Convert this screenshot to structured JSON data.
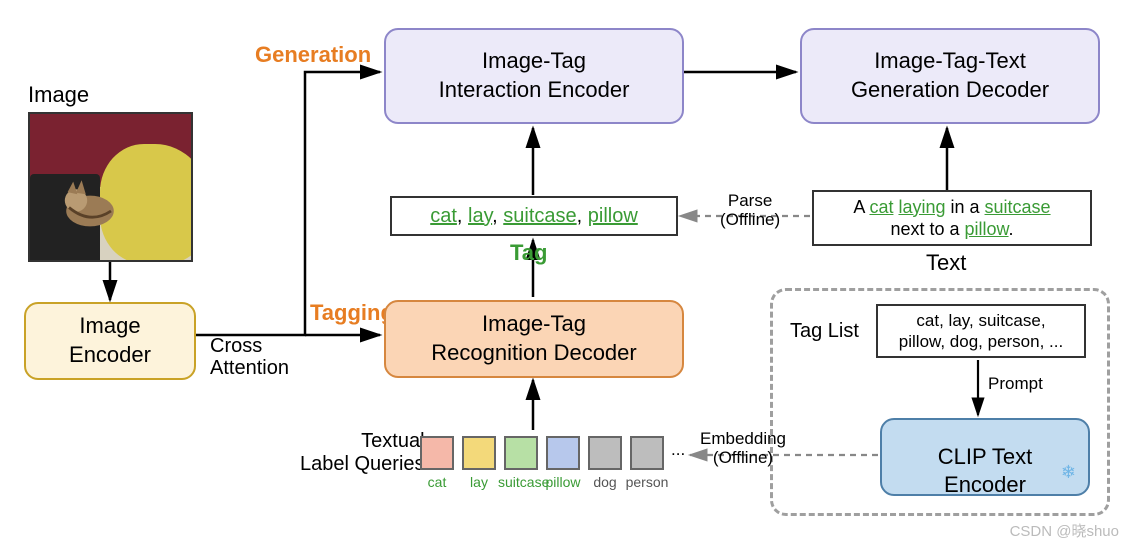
{
  "labels": {
    "image": "Image",
    "image_encoder": "Image\nEncoder",
    "generation": "Generation",
    "tagging": "Tagging",
    "cross_attention": "Cross\nAttention",
    "tag_heading": "Tag",
    "interaction_encoder": "Image-Tag\nInteraction Encoder",
    "generation_decoder": "Image-Tag-Text\nGeneration Decoder",
    "recognition_decoder": "Image-Tag\nRecognition Decoder",
    "text_heading": "Text",
    "parse": "Parse\n(Offline)",
    "embedding": "Embedding\n(Offline)",
    "tag_list_label": "Tag List",
    "prompt_label": "Prompt",
    "clip_text_encoder": "CLIP Text\nEncoder",
    "textual_label_queries": "Textual\nLabel Queries",
    "ellipsis": "...",
    "snowflake": "❄"
  },
  "tags": [
    "cat",
    "lay",
    "suitcase",
    "pillow"
  ],
  "caption": {
    "pre": "A ",
    "t0": "cat",
    "sp0": " ",
    "t1": "laying",
    "mid1": " in a ",
    "t2": "suitcase",
    "mid2": "next to a ",
    "t3": "pillow",
    "end": "."
  },
  "tag_list_text": "cat, lay, suitcase,\npillow, dog, person, ...",
  "queries": [
    {
      "label": "cat",
      "color": "#f5b8a9",
      "textcolor": "#3a9b35"
    },
    {
      "label": "lay",
      "color": "#f3d97a",
      "textcolor": "#3a9b35"
    },
    {
      "label": "suitcase",
      "color": "#b7e0a5",
      "textcolor": "#3a9b35"
    },
    {
      "label": "pillow",
      "color": "#b7c8ec",
      "textcolor": "#3a9b35"
    },
    {
      "label": "dog",
      "color": "#bdbdbd",
      "textcolor": "#555"
    },
    {
      "label": "person",
      "color": "#bdbdbd",
      "textcolor": "#555"
    }
  ]
}
